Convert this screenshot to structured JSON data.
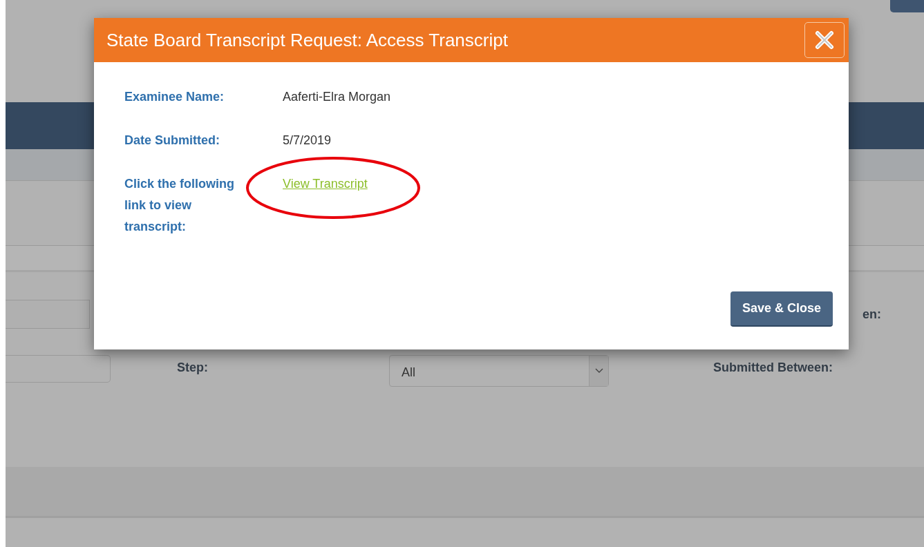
{
  "background": {
    "partial_label": "en:",
    "step_label": "Step:",
    "step_select": {
      "value": "All"
    },
    "submitted_label": "Submitted Between:"
  },
  "modal": {
    "title": "State Board Transcript Request: Access Transcript",
    "fields": [
      {
        "kind": "text",
        "label": "Examinee Name:",
        "value": "Aaferti-Elra Morgan"
      },
      {
        "kind": "text",
        "label": "Date Submitted:",
        "value": "5/7/2019"
      },
      {
        "kind": "link",
        "label": "Click the following link to view transcript:",
        "value": "View Transcript"
      }
    ],
    "buttons": [
      "Save & Close"
    ]
  }
}
